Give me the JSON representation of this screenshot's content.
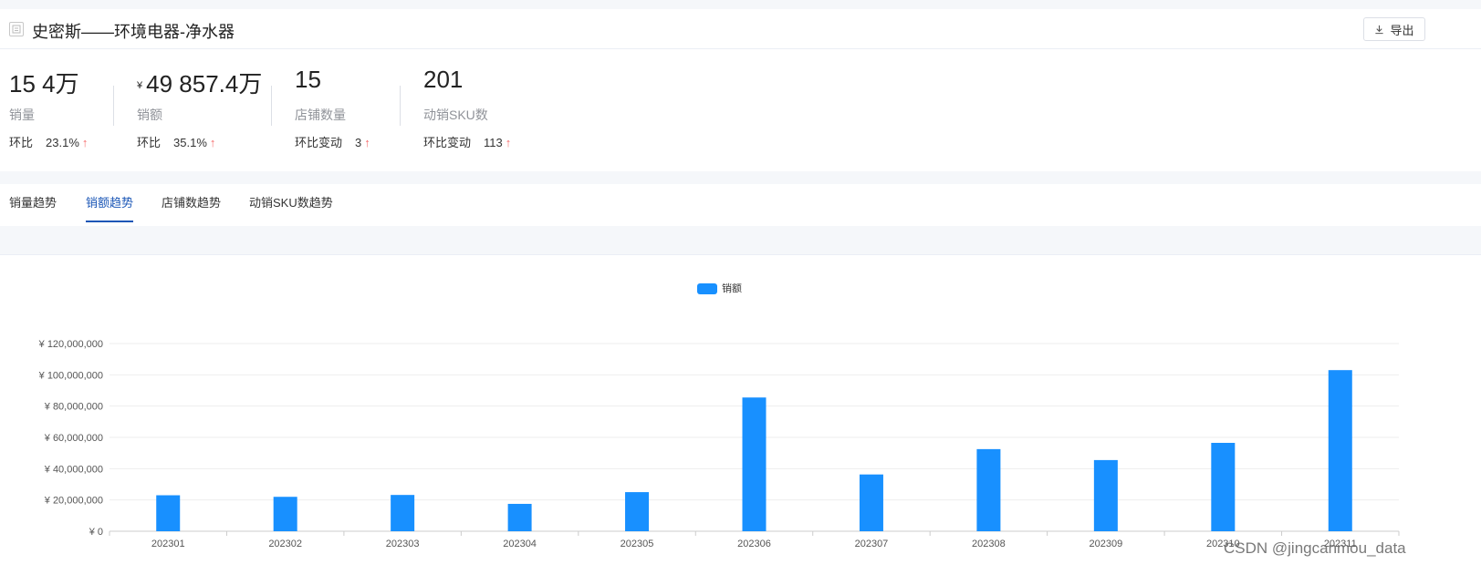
{
  "header": {
    "title": "史密斯——环境电器-净水器",
    "export_label": "导出"
  },
  "kpis": [
    {
      "value": "15 4万",
      "currency": "",
      "label": "销量",
      "change_label": "环比",
      "change_value": "23.1%",
      "arrow": "↑"
    },
    {
      "value": "49 857.4万",
      "currency": "¥",
      "label": "销额",
      "change_label": "环比",
      "change_value": "35.1%",
      "arrow": "↑"
    },
    {
      "value": "15",
      "currency": "",
      "label": "店铺数量",
      "change_label": "环比变动",
      "change_value": "3",
      "arrow": "↑"
    },
    {
      "value": "201",
      "currency": "",
      "label": "动销SKU数",
      "change_label": "环比变动",
      "change_value": "113",
      "arrow": "↑"
    }
  ],
  "tabs": [
    {
      "label": "销量趋势",
      "active": false
    },
    {
      "label": "销额趋势",
      "active": true
    },
    {
      "label": "店铺数趋势",
      "active": false
    },
    {
      "label": "动销SKU数趋势",
      "active": false
    }
  ],
  "chart_data": {
    "type": "bar",
    "categories": [
      "202301",
      "202302",
      "202303",
      "202304",
      "202305",
      "202306",
      "202307",
      "202308",
      "202309",
      "202310",
      "202311"
    ],
    "series": [
      {
        "name": "销额",
        "values": [
          23000000,
          22000000,
          23200000,
          17500000,
          25000000,
          85500000,
          36300000,
          52500000,
          45500000,
          56500000,
          103000000
        ]
      }
    ],
    "ylim": [
      0,
      120000000
    ],
    "yticks": [
      0,
      20000000,
      40000000,
      60000000,
      80000000,
      100000000,
      120000000
    ],
    "ytick_labels": [
      "¥ 0",
      "¥ 20,000,000",
      "¥ 40,000,000",
      "¥ 60,000,000",
      "¥ 80,000,000",
      "¥ 100,000,000",
      "¥ 120,000,000"
    ],
    "legend_position": "top-center",
    "grid": true,
    "bar_color": "#1890ff"
  },
  "watermark": "CSDN @jingcanmou_data"
}
